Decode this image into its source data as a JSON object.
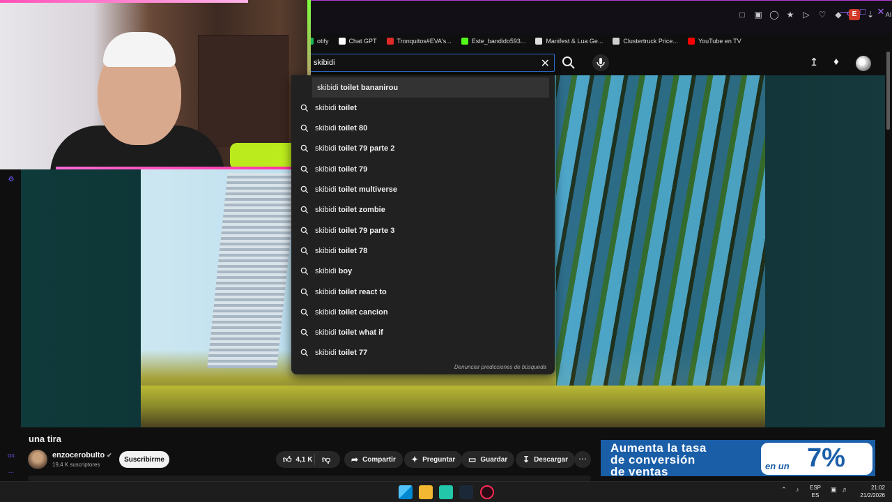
{
  "bookmarks": [
    {
      "label": "otify",
      "color": "#1db954"
    },
    {
      "label": "Chat GPT",
      "color": "#ffffff"
    },
    {
      "label": "Tronquitos#EVA's...",
      "color": "#e02a2a"
    },
    {
      "label": "Este_bandido593...",
      "color": "#53fc18"
    },
    {
      "label": "Manifest & Lua Ge...",
      "color": "#dddddd"
    },
    {
      "label": "Clustertruck Price...",
      "color": "#cfcfcf"
    },
    {
      "label": "YouTube en TV",
      "color": "#ff0000"
    }
  ],
  "extension_badge": "E",
  "extension_ai_label": "AI",
  "search": {
    "query": "skibidi",
    "prefix": "skibidi",
    "suggestions": [
      " toilet bananirou",
      " toilet",
      " toilet 80",
      " toilet 79 parte 2",
      " toilet 79",
      " toilet multiverse",
      " toilet zombie",
      " toilet 79 parte 3",
      " toilet 78",
      " boy",
      " toilet react to",
      " toilet cancion",
      " toilet what if",
      " toilet 77"
    ],
    "report_label": "Denunciar predicciones de búsqueda"
  },
  "video": {
    "title": "una tira",
    "channel": "enzocerobulto",
    "subscribers": "19,4 K suscriptores",
    "subscribe_label": "Suscribirme",
    "likes": "4,1 K",
    "share_label": "Compartir",
    "ask_label": "Preguntar",
    "save_label": "Guardar",
    "download_label": "Descargar"
  },
  "ad": {
    "line1": "Aumenta la tasa",
    "line2": "de conversión",
    "line3": "de ventas",
    "connector": "en un",
    "percent": "7%"
  },
  "rail": {
    "gx_label": "GX",
    "more_label": "..."
  },
  "taskbar": {
    "lang_top": "ESP",
    "lang_bottom": "ES",
    "time": "21:02",
    "date": "21/2/2026"
  },
  "colors": {
    "accent_purple": "#a66bff",
    "search_border": "#2d6bd0",
    "ad_blue": "#1a5ea8",
    "webcam_pink": "#ff4fb8"
  }
}
